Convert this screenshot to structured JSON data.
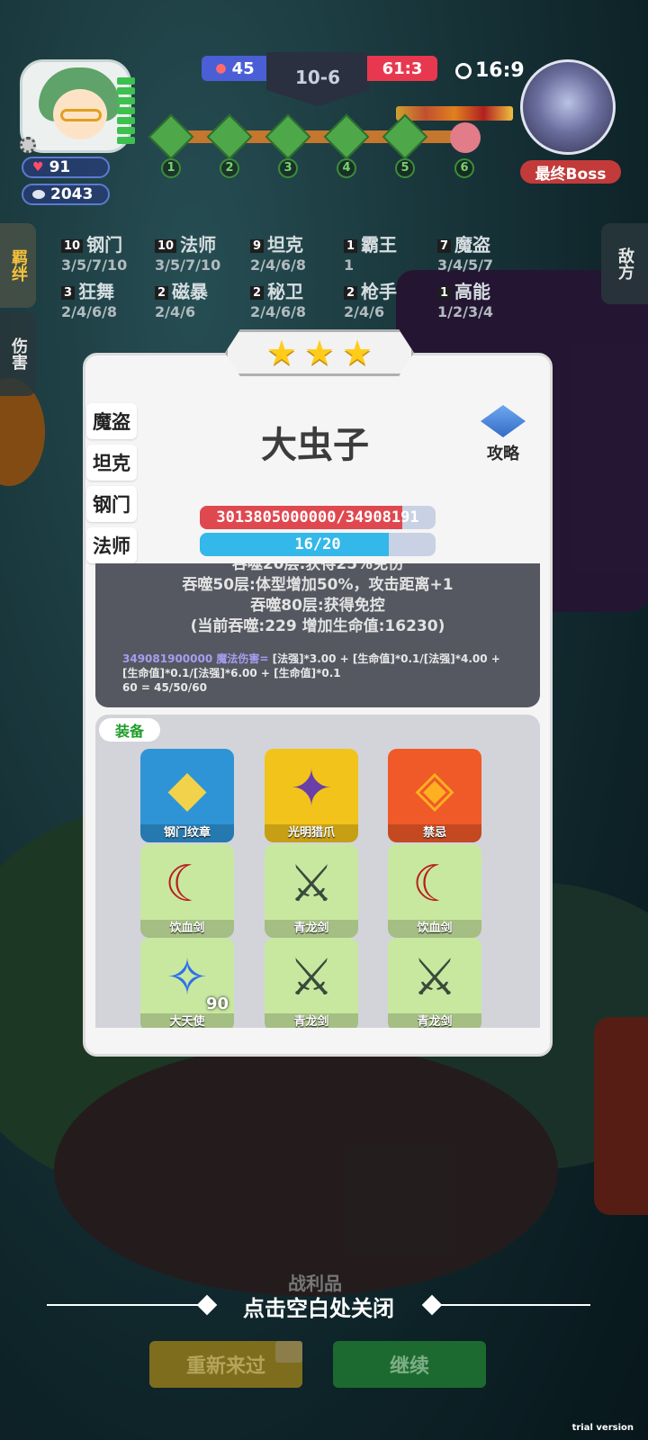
{
  "hud": {
    "hp_value": "91",
    "coin_value": "2043",
    "my_score": "45",
    "round": "10-6",
    "enemy_score": "61:3",
    "timer": "16:9",
    "boss_label": "最终Boss",
    "stages": [
      "1",
      "2",
      "3",
      "4",
      "5",
      "6"
    ]
  },
  "side_tabs": {
    "bonds": "羁绊",
    "damage": "伤害",
    "enemy": "敌方"
  },
  "bonds": [
    {
      "count": "10",
      "name": "钢门",
      "levels": "3/5/7/10"
    },
    {
      "count": "10",
      "name": "法师",
      "levels": "3/5/7/10"
    },
    {
      "count": "9",
      "name": "坦克",
      "levels": "2/4/6/8"
    },
    {
      "count": "1",
      "name": "霸王",
      "levels": "1"
    },
    {
      "count": "7",
      "name": "魔盗",
      "levels": "3/4/5/7"
    },
    {
      "count": "3",
      "name": "狂舞",
      "levels": "2/4/6/8"
    },
    {
      "count": "2",
      "name": "磁暴",
      "levels": "2/4/6"
    },
    {
      "count": "2",
      "name": "秘卫",
      "levels": "2/4/6/8"
    },
    {
      "count": "2",
      "name": "枪手",
      "levels": "2/4/6"
    },
    {
      "count": "1",
      "name": "高能",
      "levels": "1/2/3/4"
    }
  ],
  "popup": {
    "stars": 3,
    "traits": [
      "魔盗",
      "坦克",
      "钢门",
      "法师"
    ],
    "hero_name": "大虫子",
    "guide_label": "攻略",
    "hp_text": "3013805000000/34908191",
    "hp_fraction": 0.86,
    "mana_text": "16/20",
    "mana_fraction": 0.8,
    "skill_lines": [
      "吞噬20层:获得25%免伤",
      "吞噬50层:体型增加50%，攻击距离+1",
      "吞噬80层:获得免控",
      "(当前吞噬:229 增加生命值:16230)"
    ],
    "formula_value": "349081900000",
    "formula_name": " 魔法伤害=",
    "formula_rest": " [法强]*3.00 + [生命值]*0.1/[法强]*4.00 + [生命值]*0.1/[法强]*6.00 + [生命值]*0.1",
    "mana_calc": "60 = 45/50/60",
    "equip_title": "装备",
    "items": [
      {
        "name": "钢门纹章",
        "bg": "#2e94d6",
        "icon": "shield-crest-icon",
        "badge": ""
      },
      {
        "name": "光明猎爪",
        "bg": "#f2c31a",
        "icon": "claw-icon",
        "badge": ""
      },
      {
        "name": "禁忌",
        "bg": "#ef5a28",
        "icon": "gem-icon",
        "badge": ""
      },
      {
        "name": "饮血剑",
        "bg": "#c8e8a0",
        "icon": "scythe-icon",
        "badge": ""
      },
      {
        "name": "青龙剑",
        "bg": "#c8e8a0",
        "icon": "sword-icon",
        "badge": ""
      },
      {
        "name": "饮血剑",
        "bg": "#c8e8a0",
        "icon": "scythe-icon",
        "badge": ""
      },
      {
        "name": "大天使",
        "bg": "#c8e8a0",
        "icon": "staff-icon",
        "badge": "90"
      },
      {
        "name": "青龙剑",
        "bg": "#c8e8a0",
        "icon": "sword-icon",
        "badge": ""
      },
      {
        "name": "青龙剑",
        "bg": "#c8e8a0",
        "icon": "sword-icon",
        "badge": ""
      }
    ]
  },
  "bottom": {
    "loot_label": "战利品",
    "close_hint": "点击空白处关闭",
    "retry_label": "重新来过",
    "continue_label": "继续",
    "trial": "trial version"
  }
}
